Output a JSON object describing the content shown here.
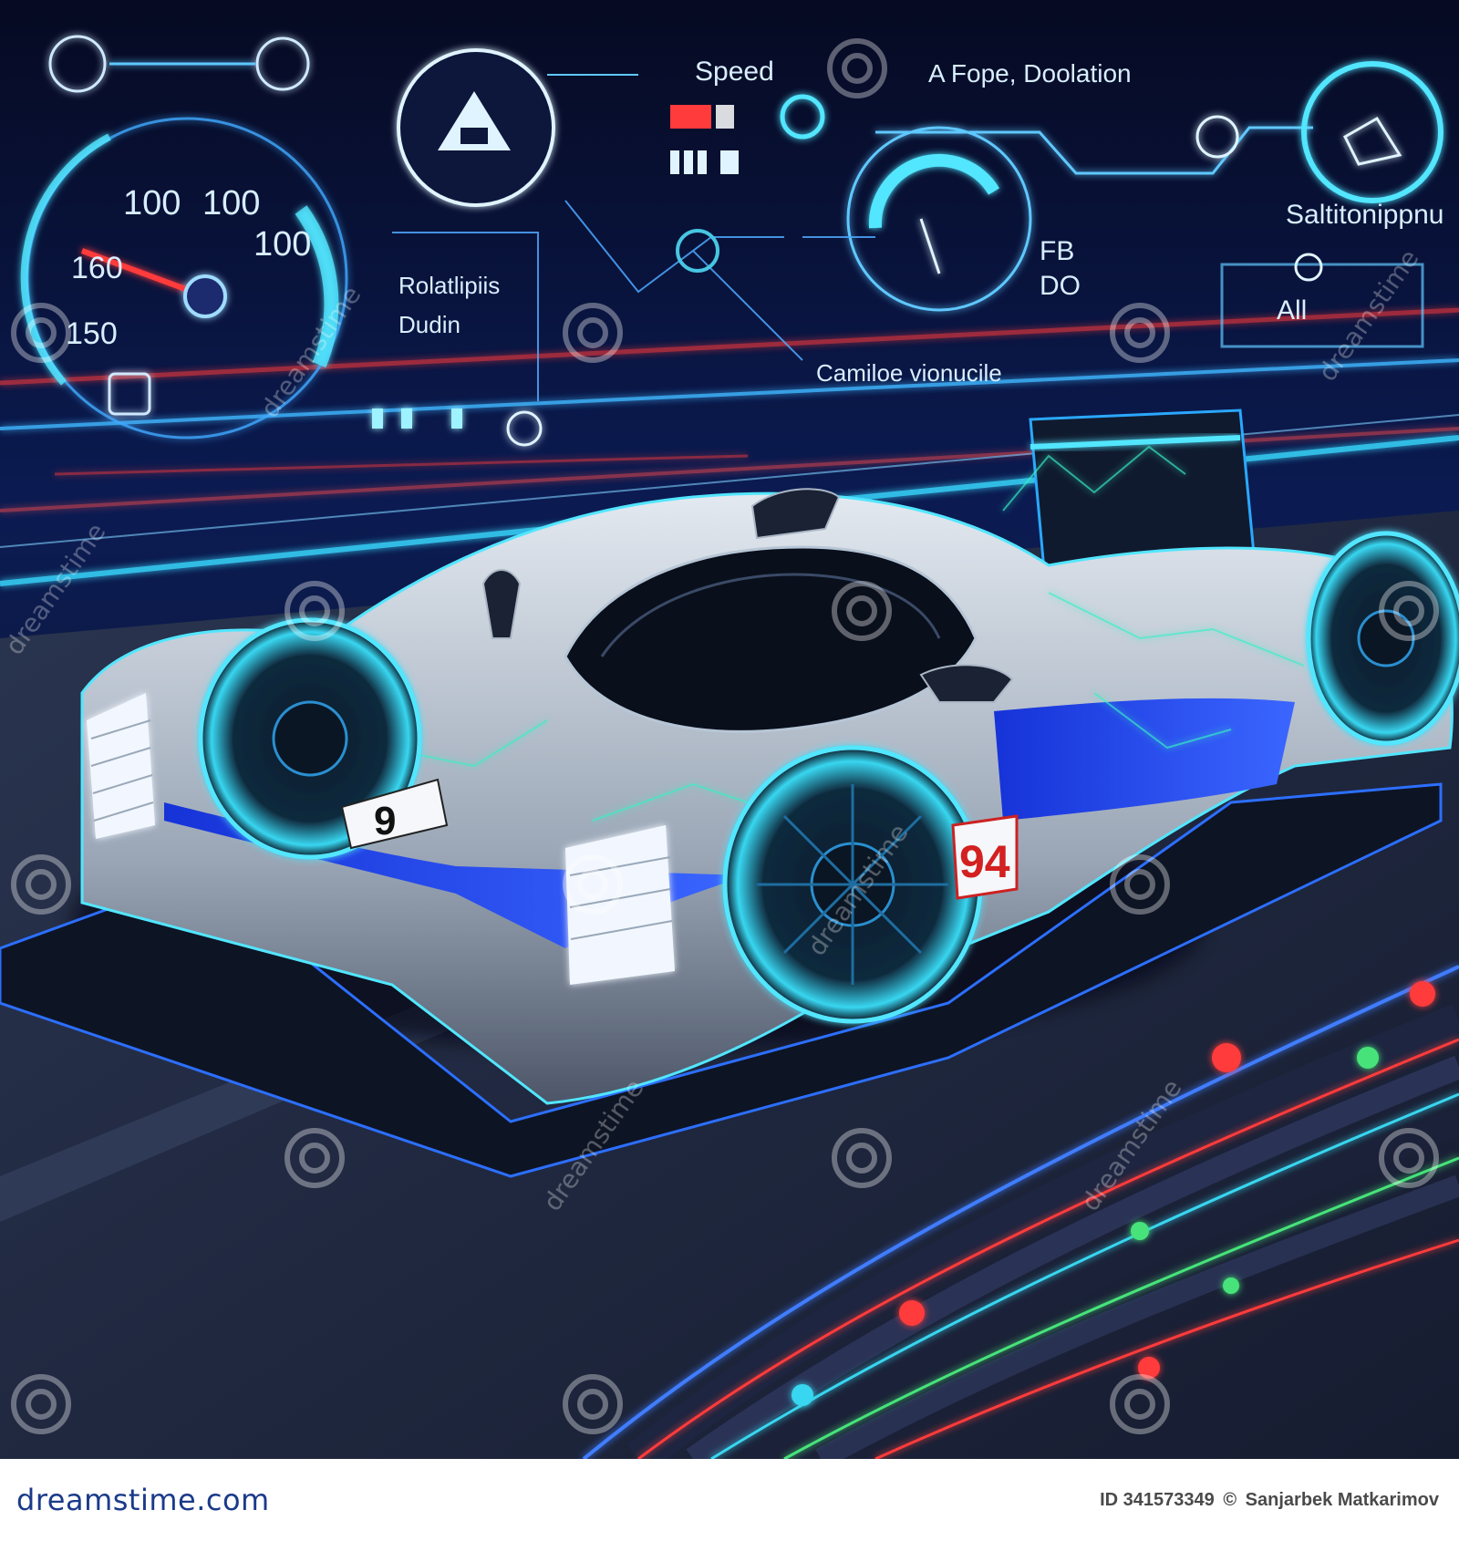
{
  "hud": {
    "speedometer_ticks": [
      "100",
      "100",
      "100",
      "160",
      "150"
    ],
    "label_speed": "Speed",
    "label_top": "A Fope, Doolation",
    "label_right": "Saltitonippnu",
    "label_left_1": "Rolatlipiis",
    "label_left_2": "Dudin",
    "label_fb": "FB",
    "label_do": "DO",
    "label_all": "All",
    "label_bottom": "Camiloe vionucile"
  },
  "car": {
    "number_front": "9",
    "number_side": "94"
  },
  "watermark": {
    "text": "dreamstime"
  },
  "footer": {
    "brand": "dreamstime.com",
    "id_text": "ID 341573349",
    "copyright": "©",
    "author": "Sanjarbek Matkarimov"
  },
  "colors": {
    "background": "#05081c",
    "hud_glow": "#52e6ff",
    "accent_red": "#ff3b3b",
    "car_blue": "#1f3ff0",
    "car_silver": "#b8c3cf"
  }
}
